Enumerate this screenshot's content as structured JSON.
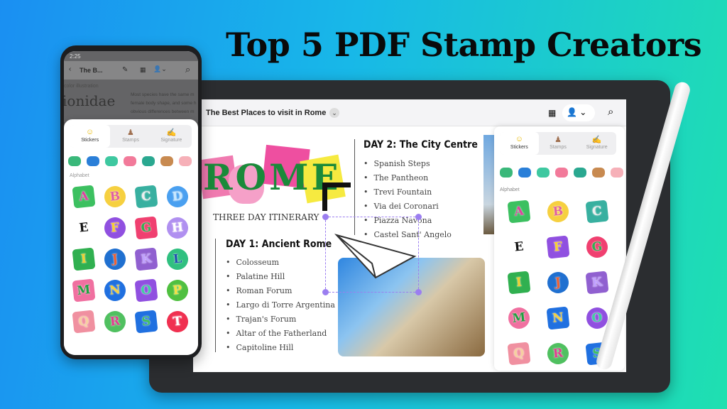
{
  "headline": "Top 5 PDF Stamp Creators",
  "colors": {
    "bg_left": "#1a8ff2",
    "bg_right": "#1fe0b0",
    "selection": "#9b7ef0"
  },
  "phone": {
    "status_time": "2:25",
    "toolbar": {
      "back_icon": "chevron-left-icon",
      "doc_title": "The B...",
      "icons": [
        "pencil-icon",
        "translate-icon",
        "stamp-user-icon",
        "chevron-down-icon",
        "search-icon"
      ]
    },
    "doc": {
      "caption": "color illustration",
      "heading": "ionidae",
      "body": [
        "Most species have the same m",
        "female body shape, and some h",
        "obvious differences between m"
      ]
    },
    "tabs": [
      {
        "label": "Stickers",
        "icon": "smiley-icon",
        "active": true
      },
      {
        "label": "Stamps",
        "icon": "stamp-icon",
        "active": false
      },
      {
        "label": "Signature",
        "icon": "signature-icon",
        "active": false
      }
    ],
    "section_label": "Alphabet",
    "letters": [
      "A",
      "B",
      "C",
      "D",
      "E",
      "F",
      "G",
      "H",
      "I",
      "J",
      "K",
      "L",
      "M",
      "N",
      "O",
      "P",
      "Q",
      "R",
      "S",
      "T"
    ]
  },
  "tablet": {
    "doc_title": "The Best Places to visit in Rome",
    "toolbar_icons": [
      "chevron-down-icon",
      "translate-icon",
      "stamp-user-icon",
      "chevron-down-icon",
      "search-icon"
    ],
    "art_word": "ROME",
    "subtitle": "THREE DAY ITINERARY",
    "day1": {
      "heading": "DAY 1: Ancient Rome",
      "items": [
        "Colosseum",
        "Palatine Hill",
        "Roman Forum",
        "Largo di Torre Argentina",
        "Trajan's Forum",
        "Altar of the Fatherland",
        "Capitoline Hill"
      ]
    },
    "day2": {
      "heading": "DAY 2: The City Centre",
      "items": [
        "Spanish Steps",
        "The Pantheon",
        "Trevi Fountain",
        "Via dei Coronari",
        "Piazza Navona",
        "Castel Sant' Angelo"
      ]
    },
    "tabs": [
      {
        "label": "Stickers",
        "icon": "smiley-icon",
        "active": true
      },
      {
        "label": "Stamps",
        "icon": "stamp-icon",
        "active": false
      },
      {
        "label": "Signature",
        "icon": "signature-icon",
        "active": false
      }
    ],
    "section_label": "Alphabet",
    "letters": [
      "A",
      "B",
      "C",
      "E",
      "F",
      "G",
      "I",
      "J",
      "K",
      "M",
      "N",
      "O",
      "Q",
      "R",
      "S"
    ]
  }
}
